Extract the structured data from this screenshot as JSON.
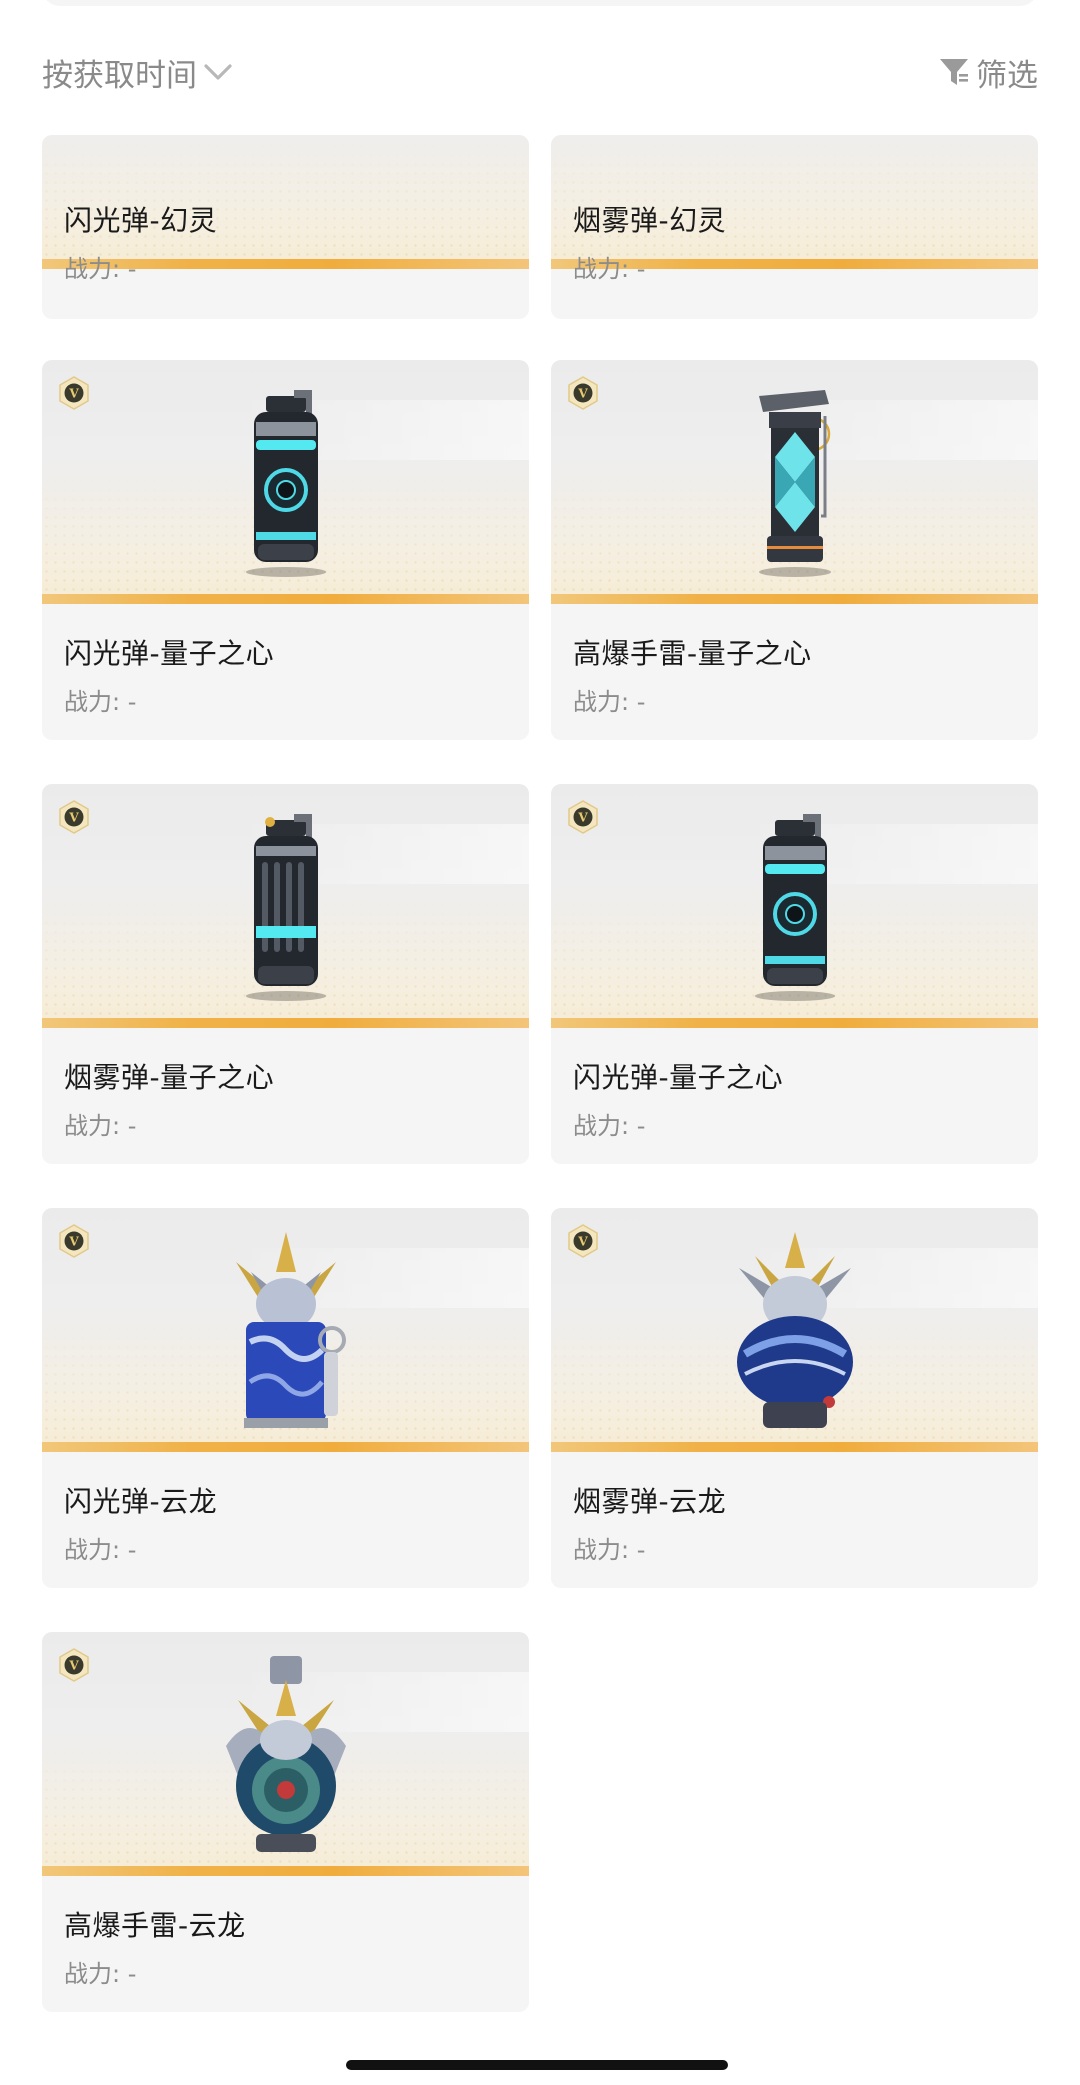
{
  "toolbar": {
    "sort_label": "按获取时间",
    "filter_label": "筛选"
  },
  "items": [
    {
      "name": "闪光弹-幻灵",
      "power": "战力: -",
      "image": "flashbang-phantom"
    },
    {
      "name": "烟雾弹-幻灵",
      "power": "战力: -",
      "image": "smoke-grenade-phantom"
    },
    {
      "name": "闪光弹-量子之心",
      "power": "战力: -",
      "image": "flashbang-quantum-heart",
      "badge": "V"
    },
    {
      "name": "高爆手雷-量子之心",
      "power": "战力: -",
      "image": "frag-grenade-quantum-heart",
      "badge": "V"
    },
    {
      "name": "烟雾弹-量子之心",
      "power": "战力: -",
      "image": "smoke-grenade-quantum-heart",
      "badge": "V"
    },
    {
      "name": "闪光弹-量子之心",
      "power": "战力: -",
      "image": "flashbang-quantum-heart",
      "badge": "V"
    },
    {
      "name": "闪光弹-云龙",
      "power": "战力: -",
      "image": "flashbang-cloud-dragon",
      "badge": "V"
    },
    {
      "name": "烟雾弹-云龙",
      "power": "战力: -",
      "image": "smoke-grenade-cloud-dragon",
      "badge": "V"
    },
    {
      "name": "高爆手雷-云龙",
      "power": "战力: -",
      "image": "frag-grenade-cloud-dragon",
      "badge": "V"
    }
  ],
  "colors": {
    "accent_stripe": "#f0b248",
    "card_bg": "#f5f5f5",
    "muted_text": "#8a8a8a",
    "badge_gold": "#c9a64a"
  }
}
